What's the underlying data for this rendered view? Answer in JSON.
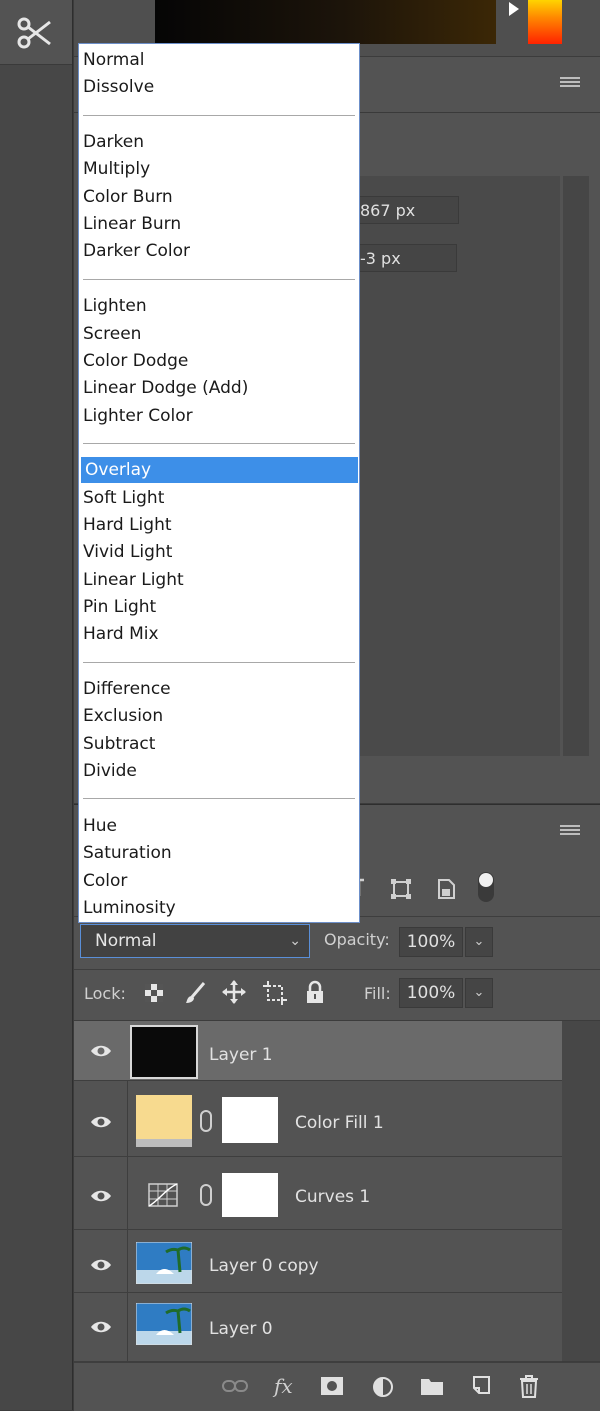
{
  "blend_menu": {
    "groups": [
      [
        "Normal",
        "Dissolve"
      ],
      [
        "Darken",
        "Multiply",
        "Color Burn",
        "Linear Burn",
        "Darker Color"
      ],
      [
        "Lighten",
        "Screen",
        "Color Dodge",
        "Linear Dodge (Add)",
        "Lighter Color"
      ],
      [
        "Overlay",
        "Soft Light",
        "Hard Light",
        "Vivid Light",
        "Linear Light",
        "Pin Light",
        "Hard Mix"
      ],
      [
        "Difference",
        "Exclusion",
        "Subtract",
        "Divide"
      ],
      [
        "Hue",
        "Saturation",
        "Color",
        "Luminosity"
      ]
    ],
    "highlighted": "Overlay"
  },
  "properties": {
    "width_value": "867 px",
    "height_value": "-3 px"
  },
  "layers_panel": {
    "blend_mode": "Normal",
    "opacity_label": "Opacity:",
    "opacity_value": "100%",
    "lock_label": "Lock:",
    "fill_label": "Fill:",
    "fill_value": "100%",
    "layers": [
      {
        "name": "Layer 1",
        "selected": true
      },
      {
        "name": "Color Fill 1",
        "selected": false
      },
      {
        "name": "Curves 1",
        "selected": false
      },
      {
        "name": "Layer 0 copy",
        "selected": false
      },
      {
        "name": "Layer 0",
        "selected": false
      }
    ]
  },
  "colors": {
    "highlight": "#3d8fe8",
    "fill_swatch": "#f7da8f"
  }
}
